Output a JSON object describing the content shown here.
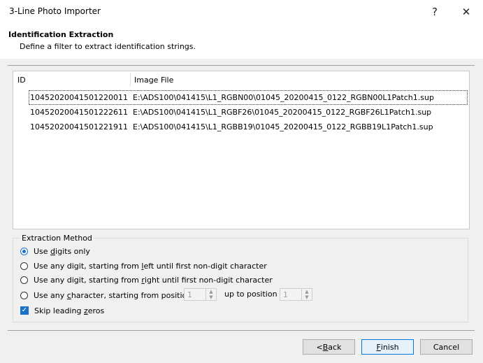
{
  "window": {
    "title": "3-Line Photo Importer",
    "help_glyph": "?",
    "close_glyph": "✕"
  },
  "header": {
    "title": "Identification Extraction",
    "subtitle": "Define a filter to extract identification strings."
  },
  "table": {
    "columns": [
      "ID",
      "Image File"
    ],
    "rows": [
      {
        "id": "10452020041501220011",
        "file": "E:\\ADS100\\041415\\L1_RGBN00\\01045_20200415_0122_RGBN00L1Patch1.sup"
      },
      {
        "id": "10452020041501222611",
        "file": "E:\\ADS100\\041415\\L1_RGBF26\\01045_20200415_0122_RGBF26L1Patch1.sup"
      },
      {
        "id": "10452020041501221911",
        "file": "E:\\ADS100\\041415\\L1_RGBB19\\01045_20200415_0122_RGBB19L1Patch1.sup"
      }
    ]
  },
  "extraction": {
    "legend": "Extraction Method",
    "options": [
      {
        "pre": "Use ",
        "key": "d",
        "post": "igits only",
        "selected": true
      },
      {
        "pre": "Use any digit, starting from ",
        "key": "l",
        "post": "eft until first non-digit character",
        "selected": false
      },
      {
        "pre": "Use any digit, starting from ",
        "key": "r",
        "post": "ight until first non-digit character",
        "selected": false
      },
      {
        "pre": "Use any ",
        "key": "c",
        "post": "haracter, starting from position",
        "selected": false
      }
    ],
    "start_position": "1",
    "up_to_label": "up to position",
    "end_position": "1",
    "skip_zeros": {
      "pre": "Skip leading ",
      "key": "z",
      "post": "eros",
      "checked": true
    }
  },
  "buttons": {
    "back": {
      "pre": "< ",
      "key": "B",
      "post": "ack"
    },
    "finish": {
      "key": "F",
      "post": "inish"
    },
    "cancel": "Cancel"
  }
}
